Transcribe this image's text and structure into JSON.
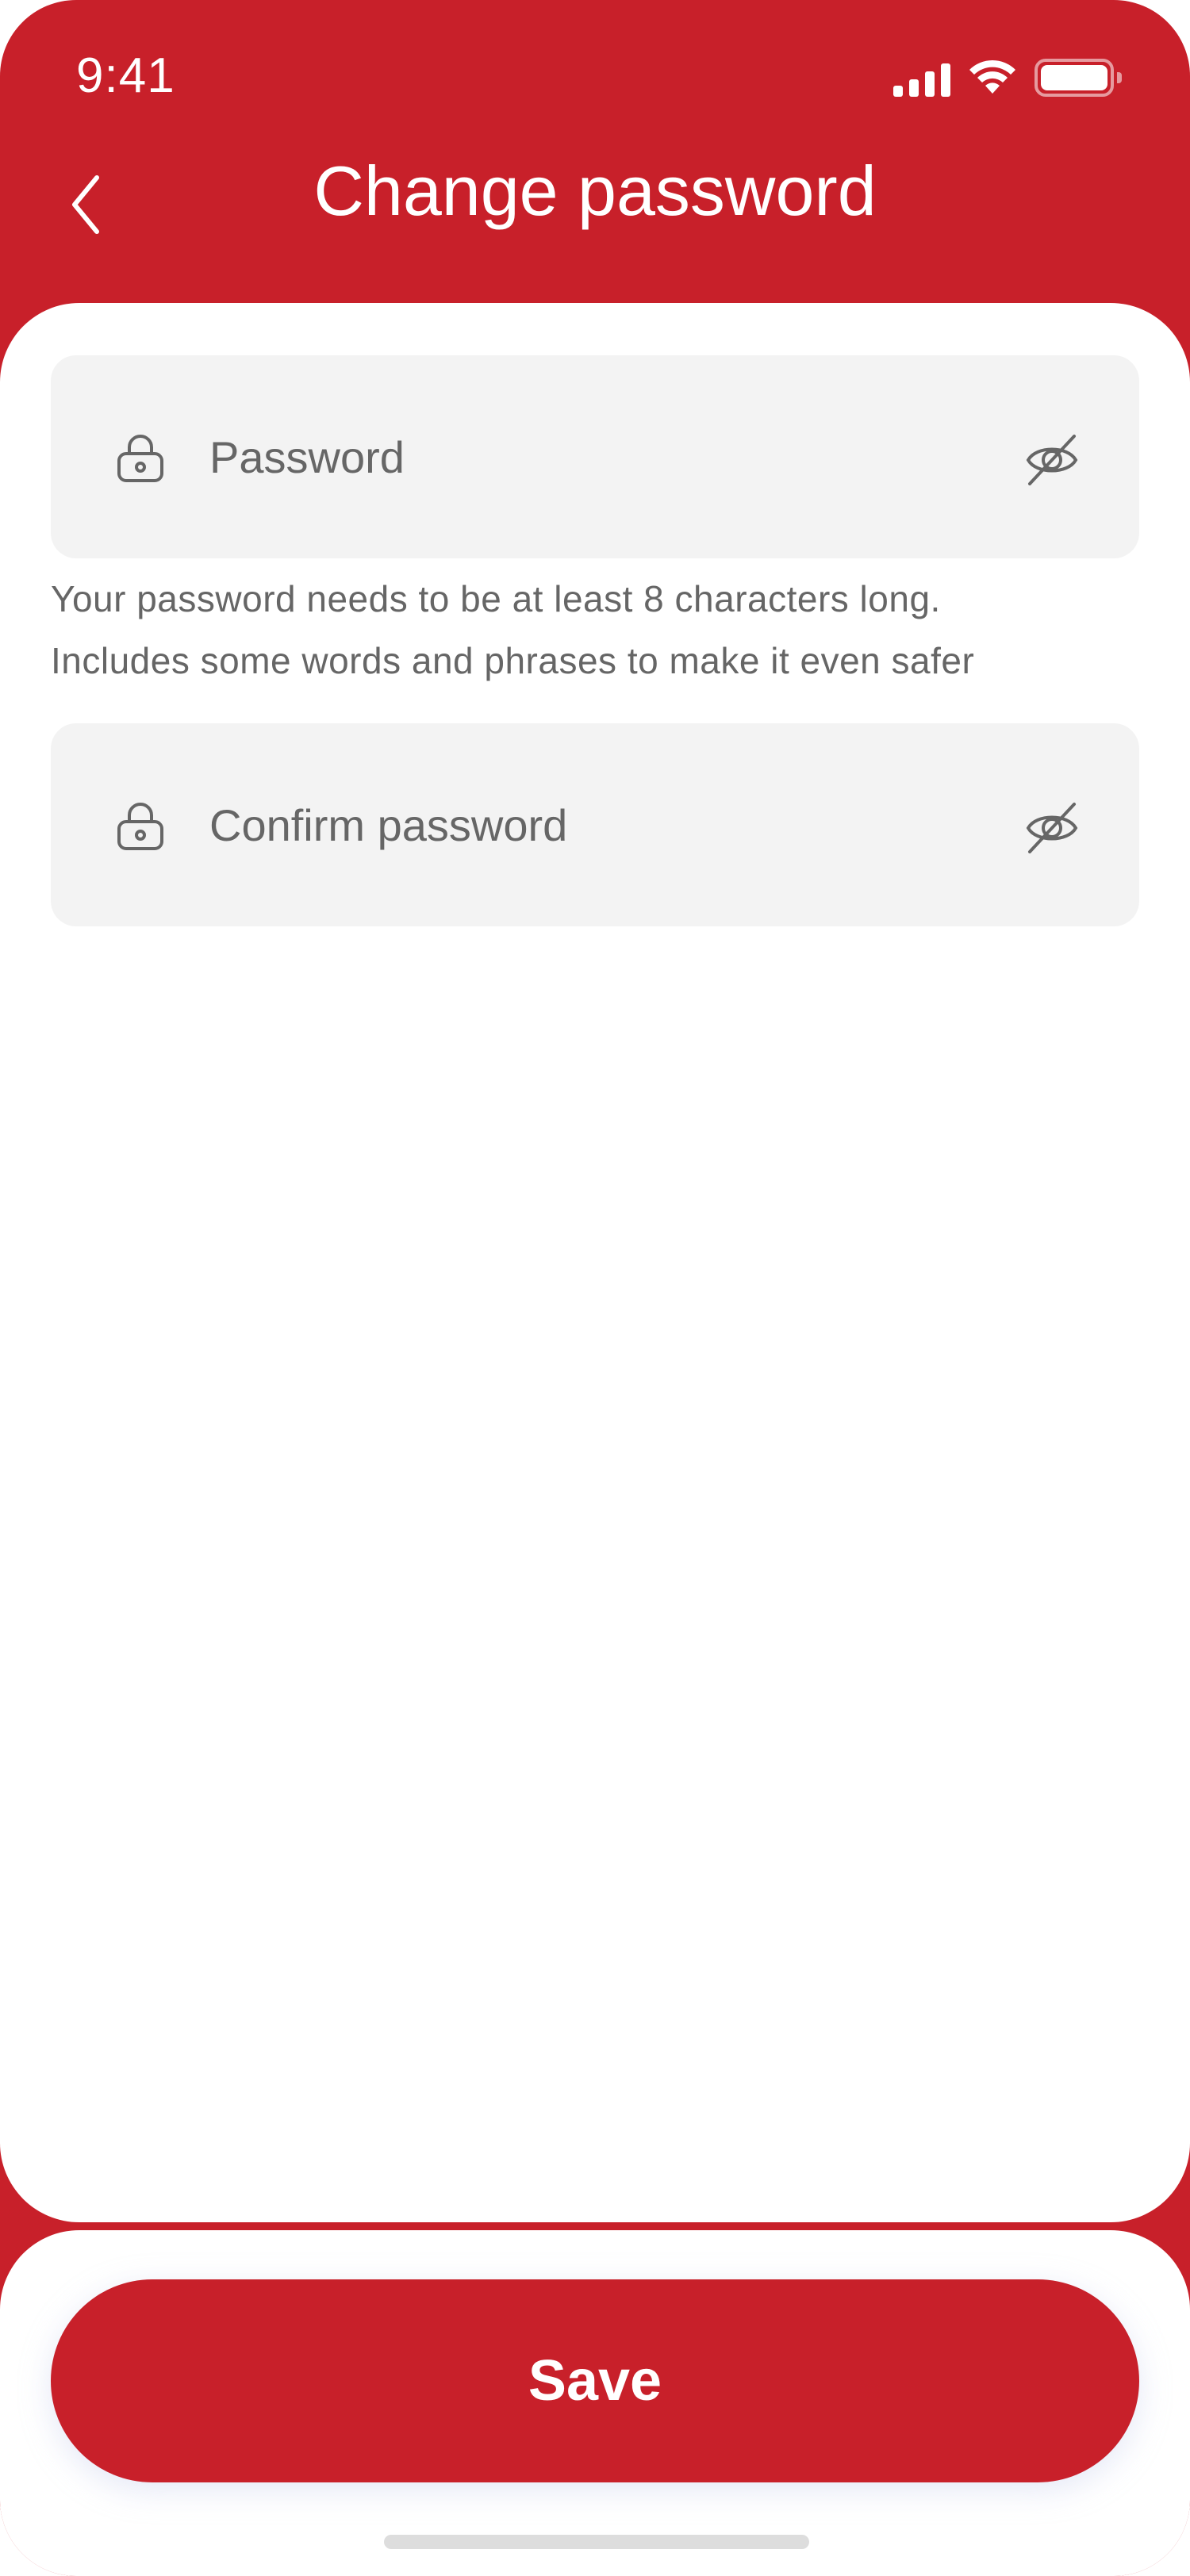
{
  "status_bar": {
    "time": "9:41"
  },
  "header": {
    "title": "Change password",
    "back_icon": "chevron-left-icon"
  },
  "form": {
    "password": {
      "value": "",
      "placeholder": "Password",
      "leading_icon": "lock-icon",
      "trailing_icon": "eye-off-icon"
    },
    "helper_text_line1": "Your password needs to be at least 8 characters long.",
    "helper_text_line2": "Includes some words and phrases to make it even safer",
    "confirm_password": {
      "value": "",
      "placeholder": "Confirm password",
      "leading_icon": "lock-icon",
      "trailing_icon": "eye-off-icon"
    }
  },
  "footer": {
    "save_label": "Save"
  },
  "colors": {
    "brand_red": "#C8202A",
    "field_bg": "#F3F3F3",
    "text_secondary": "#666666"
  }
}
